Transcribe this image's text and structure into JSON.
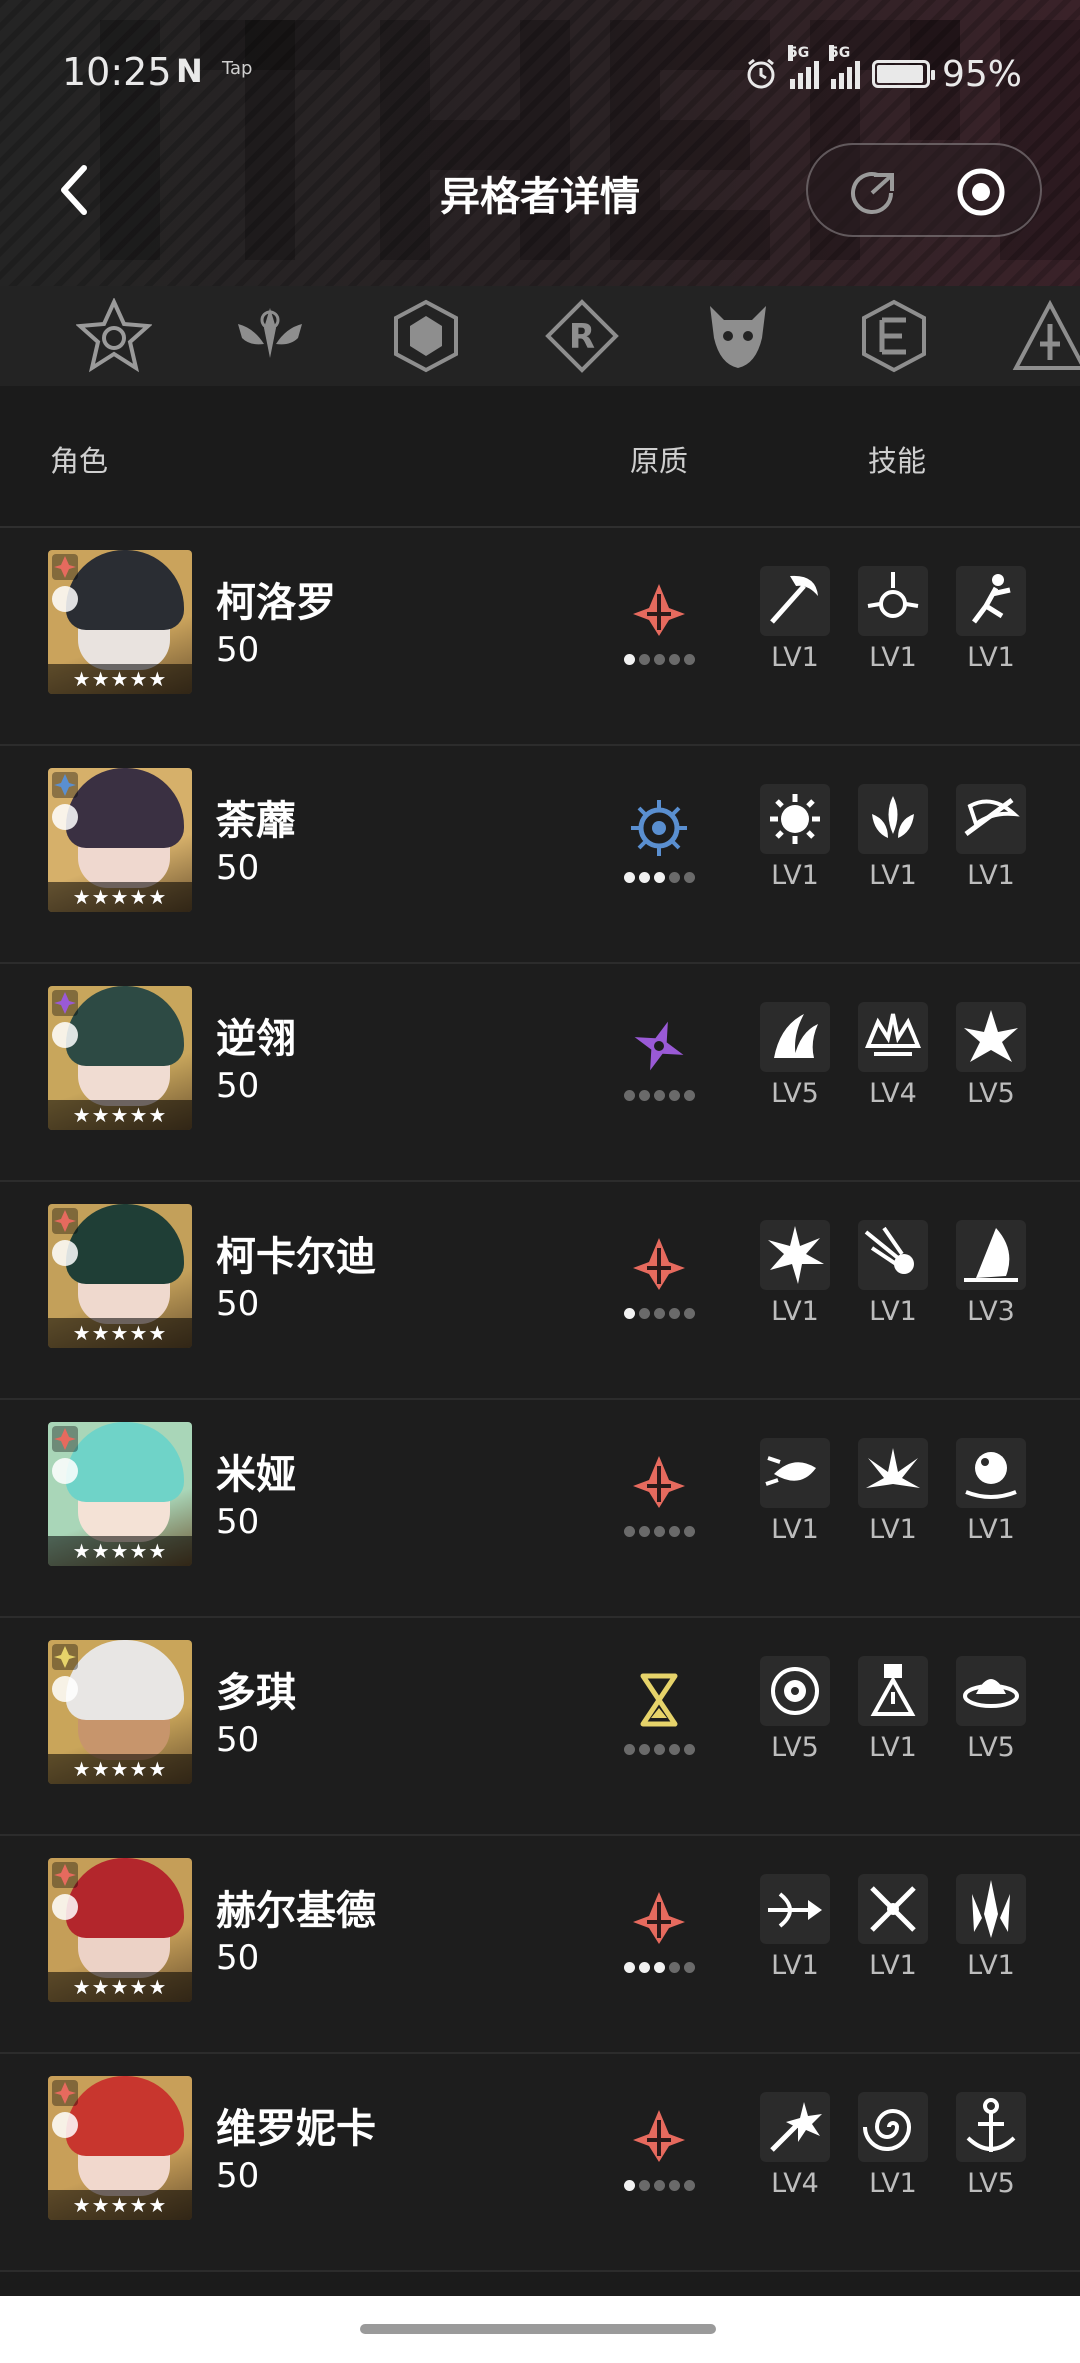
{
  "status_bar": {
    "time": "10:25",
    "nfc": "N",
    "tap": "Tap",
    "battery_pct": "95%",
    "battery_level": 0.95,
    "net_labels": [
      "5G",
      "5G"
    ]
  },
  "header": {
    "title": "异格者详情"
  },
  "categories": [
    {
      "icon": "star-crest-icon"
    },
    {
      "icon": "winged-crest-icon"
    },
    {
      "icon": "hexagon-crest-icon"
    },
    {
      "icon": "r-emblem-icon"
    },
    {
      "icon": "beast-mask-icon"
    },
    {
      "icon": "e-emblem-icon"
    },
    {
      "icon": "pyramid-emblem-icon"
    }
  ],
  "table_head": {
    "role": "角色",
    "quality": "原质",
    "skill": "技能"
  },
  "characters": [
    {
      "name": "柯洛罗",
      "level": "50",
      "quality_icon": "red-pylon-icon",
      "quality_color": "#e66a5e",
      "quality_dots": 1,
      "avatar_colors": {
        "bg": "#caa35c",
        "hair": "#2a2d33",
        "face": "#e9e3df"
      },
      "skills": [
        {
          "icon": "scythe-icon",
          "level": "LV1"
        },
        {
          "icon": "orbit-burst-icon",
          "level": "LV1"
        },
        {
          "icon": "leap-figure-icon",
          "level": "LV1"
        }
      ]
    },
    {
      "name": "荼蘼",
      "level": "50",
      "quality_icon": "blue-sun-eye-icon",
      "quality_color": "#5a8fd0",
      "quality_dots": 3,
      "avatar_colors": {
        "bg": "#d6b06a",
        "hair": "#3a3042",
        "face": "#efd8cf"
      },
      "skills": [
        {
          "icon": "gear-orb-icon",
          "level": "LV1"
        },
        {
          "icon": "flame-lotus-icon",
          "level": "LV1"
        },
        {
          "icon": "ribbon-sword-icon",
          "level": "LV1"
        }
      ]
    },
    {
      "name": "逆翎",
      "level": "50",
      "quality_icon": "purple-shuriken-icon",
      "quality_color": "#9a5ad6",
      "quality_dots": 0,
      "avatar_colors": {
        "bg": "#c8a65c",
        "hair": "#2d4a44",
        "face": "#f0dcd2"
      },
      "skills": [
        {
          "icon": "wing-blades-icon",
          "level": "LV5"
        },
        {
          "icon": "crown-spire-icon",
          "level": "LV4"
        },
        {
          "icon": "crystal-burst-icon",
          "level": "LV5"
        }
      ]
    },
    {
      "name": "柯卡尔迪",
      "level": "50",
      "quality_icon": "red-pylon-icon",
      "quality_color": "#e66a5e",
      "quality_dots": 1,
      "avatar_colors": {
        "bg": "#c3a05a",
        "hair": "#1f3e36",
        "face": "#efd9ce"
      },
      "skills": [
        {
          "icon": "explosion-icon",
          "level": "LV1"
        },
        {
          "icon": "comet-icon",
          "level": "LV1"
        },
        {
          "icon": "sail-blade-icon",
          "level": "LV3"
        }
      ]
    },
    {
      "name": "米娅",
      "level": "50",
      "quality_icon": "red-pylon-icon",
      "quality_color": "#e66a5e",
      "quality_dots": 0,
      "avatar_colors": {
        "bg": "#a9d6b8",
        "hair": "#6fd3c8",
        "face": "#f4e2d6"
      },
      "skills": [
        {
          "icon": "fish-dash-icon",
          "level": "LV1"
        },
        {
          "icon": "splash-icon",
          "level": "LV1"
        },
        {
          "icon": "bubble-orb-icon",
          "level": "LV1"
        }
      ]
    },
    {
      "name": "多琪",
      "level": "50",
      "quality_icon": "yellow-hourglass-icon",
      "quality_color": "#e6d36a",
      "quality_dots": 0,
      "avatar_colors": {
        "bg": "#c9a55a",
        "hair": "#e8e6e4",
        "face": "#c7956c"
      },
      "skills": [
        {
          "icon": "target-ring-icon",
          "level": "LV5"
        },
        {
          "icon": "warning-tower-icon",
          "level": "LV1"
        },
        {
          "icon": "saucer-icon",
          "level": "LV5"
        }
      ]
    },
    {
      "name": "赫尔基德",
      "level": "50",
      "quality_icon": "red-pylon-icon",
      "quality_color": "#e66a5e",
      "quality_dots": 3,
      "avatar_colors": {
        "bg": "#c59e58",
        "hair": "#b3262c",
        "face": "#ecd2c6"
      },
      "skills": [
        {
          "icon": "arrow-shot-icon",
          "level": "LV1"
        },
        {
          "icon": "crossed-swords-icon",
          "level": "LV1"
        },
        {
          "icon": "shard-spikes-icon",
          "level": "LV1"
        }
      ]
    },
    {
      "name": "维罗妮卡",
      "level": "50",
      "quality_icon": "red-pylon-icon",
      "quality_color": "#e66a5e",
      "quality_dots": 1,
      "avatar_colors": {
        "bg": "#c89f59",
        "hair": "#c8362e",
        "face": "#f1d8cd"
      },
      "skills": [
        {
          "icon": "spark-burst-icon",
          "level": "LV4"
        },
        {
          "icon": "vortex-icon",
          "level": "LV1"
        },
        {
          "icon": "anchor-icon",
          "level": "LV5"
        }
      ]
    }
  ]
}
